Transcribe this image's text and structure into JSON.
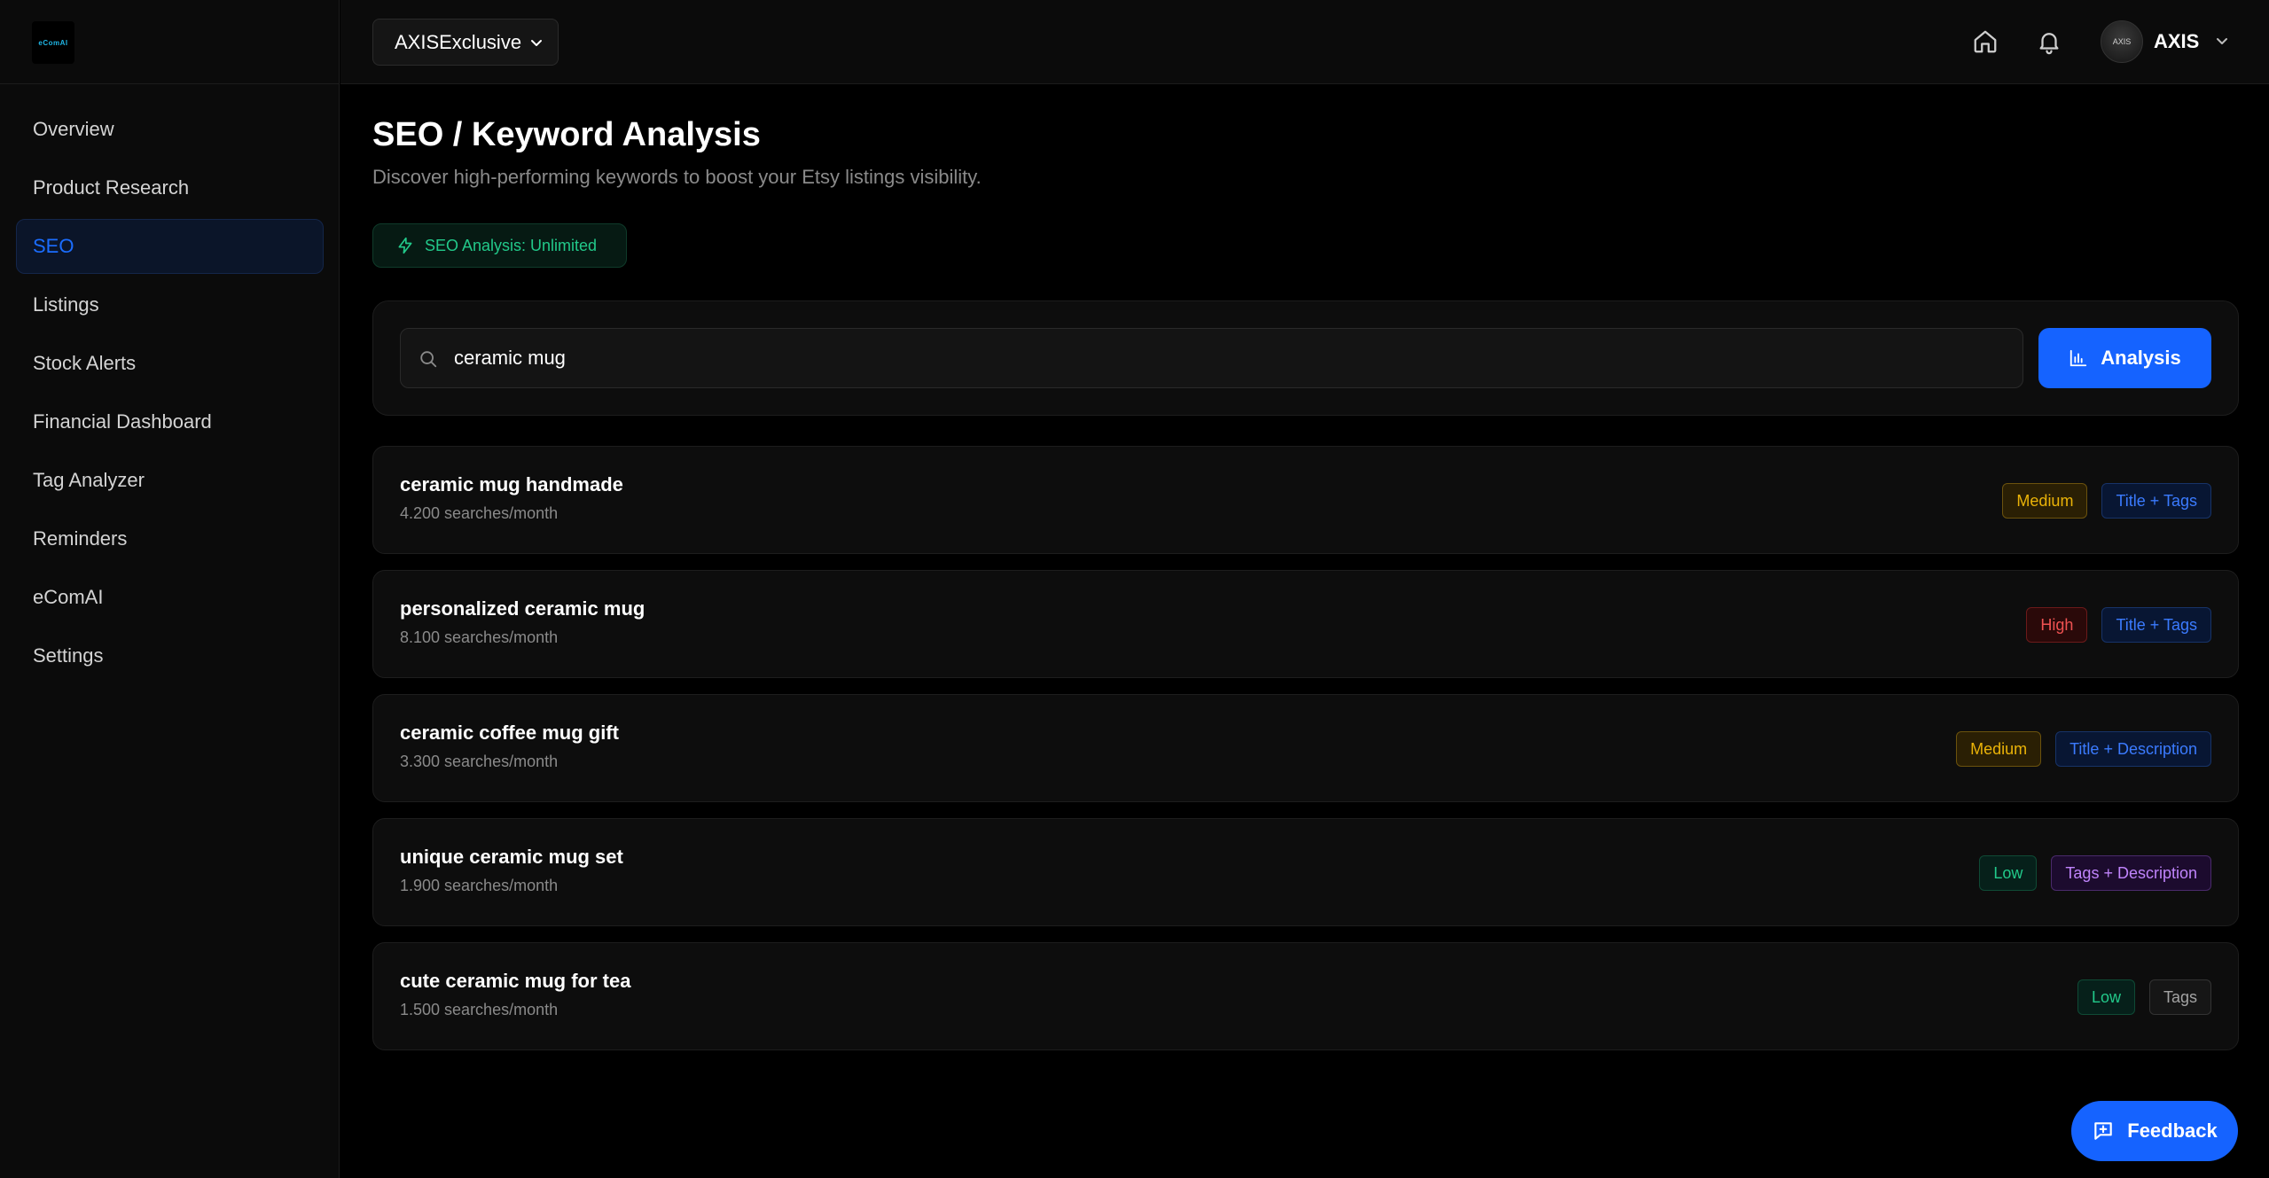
{
  "brand": {
    "logo_text": "eComAI"
  },
  "sidebar": {
    "items": [
      {
        "label": "Overview",
        "active": false
      },
      {
        "label": "Product Research",
        "active": false
      },
      {
        "label": "SEO",
        "active": true
      },
      {
        "label": "Listings",
        "active": false
      },
      {
        "label": "Stock Alerts",
        "active": false
      },
      {
        "label": "Financial Dashboard",
        "active": false
      },
      {
        "label": "Tag Analyzer",
        "active": false
      },
      {
        "label": "Reminders",
        "active": false
      },
      {
        "label": "eComAI",
        "active": false
      },
      {
        "label": "Settings",
        "active": false
      }
    ]
  },
  "topbar": {
    "store_select": "AXISExclusive",
    "user_name": "AXIS",
    "avatar_text": "AXIS",
    "icons": [
      "home-icon",
      "bell-icon",
      "chevron-down-icon"
    ]
  },
  "page": {
    "title": "SEO / Keyword Analysis",
    "subtitle": "Discover high-performing keywords to boost your Etsy listings visibility.",
    "quota_badge": "SEO Analysis: Unlimited"
  },
  "search": {
    "value": "ceramic mug",
    "button_label": "Analysis"
  },
  "results": [
    {
      "keyword": "ceramic mug handmade",
      "volume": "4.200 searches/month",
      "competition": "Medium",
      "placement": "Title + Tags"
    },
    {
      "keyword": "personalized ceramic mug",
      "volume": "8.100 searches/month",
      "competition": "High",
      "placement": "Title + Tags"
    },
    {
      "keyword": "ceramic coffee mug gift",
      "volume": "3.300 searches/month",
      "competition": "Medium",
      "placement": "Title + Description"
    },
    {
      "keyword": "unique ceramic mug set",
      "volume": "1.900 searches/month",
      "competition": "Low",
      "placement": "Tags + Description"
    },
    {
      "keyword": "cute ceramic mug for tea",
      "volume": "1.500 searches/month",
      "competition": "Low",
      "placement": "Tags"
    }
  ],
  "feedback": {
    "label": "Feedback"
  },
  "colors": {
    "accent": "#1563ff",
    "medium": "#eab308",
    "high": "#f05252",
    "low": "#22c98a",
    "purple": "#c084fc"
  }
}
